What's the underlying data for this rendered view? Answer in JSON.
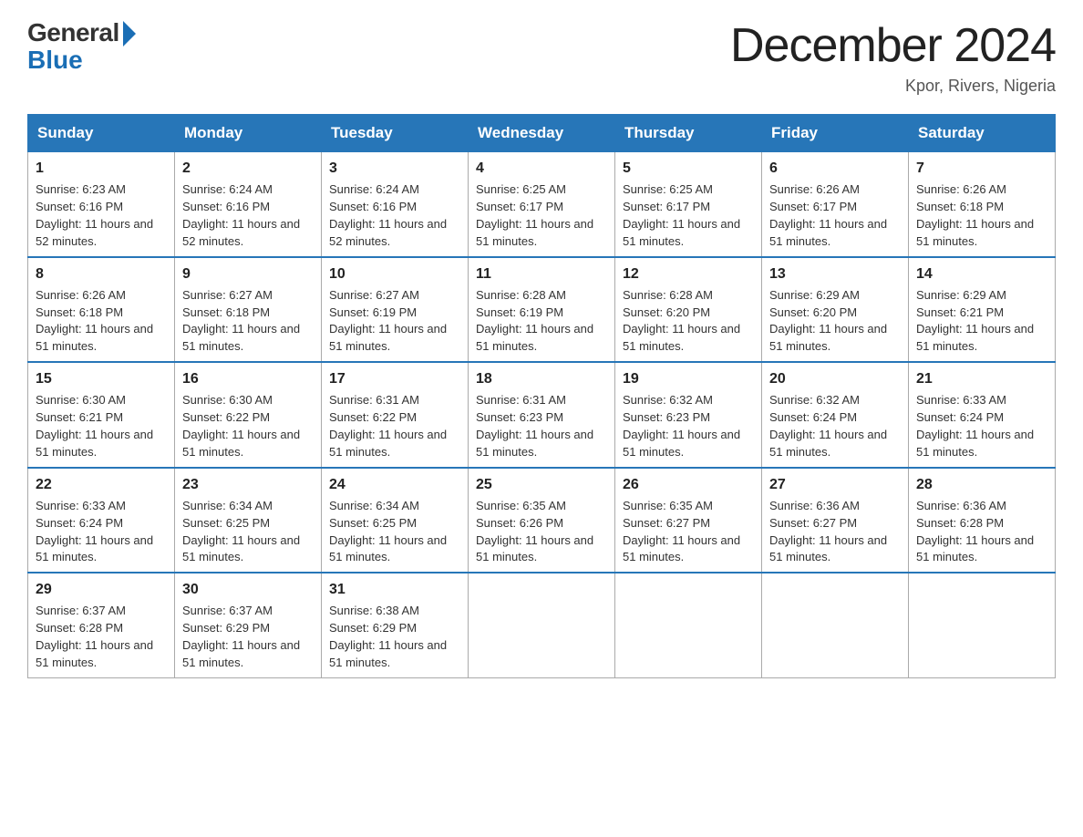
{
  "logo": {
    "general": "General",
    "blue": "Blue"
  },
  "title": "December 2024",
  "location": "Kpor, Rivers, Nigeria",
  "days": [
    "Sunday",
    "Monday",
    "Tuesday",
    "Wednesday",
    "Thursday",
    "Friday",
    "Saturday"
  ],
  "weeks": [
    [
      {
        "num": "1",
        "sunrise": "6:23 AM",
        "sunset": "6:16 PM",
        "daylight": "11 hours and 52 minutes."
      },
      {
        "num": "2",
        "sunrise": "6:24 AM",
        "sunset": "6:16 PM",
        "daylight": "11 hours and 52 minutes."
      },
      {
        "num": "3",
        "sunrise": "6:24 AM",
        "sunset": "6:16 PM",
        "daylight": "11 hours and 52 minutes."
      },
      {
        "num": "4",
        "sunrise": "6:25 AM",
        "sunset": "6:17 PM",
        "daylight": "11 hours and 51 minutes."
      },
      {
        "num": "5",
        "sunrise": "6:25 AM",
        "sunset": "6:17 PM",
        "daylight": "11 hours and 51 minutes."
      },
      {
        "num": "6",
        "sunrise": "6:26 AM",
        "sunset": "6:17 PM",
        "daylight": "11 hours and 51 minutes."
      },
      {
        "num": "7",
        "sunrise": "6:26 AM",
        "sunset": "6:18 PM",
        "daylight": "11 hours and 51 minutes."
      }
    ],
    [
      {
        "num": "8",
        "sunrise": "6:26 AM",
        "sunset": "6:18 PM",
        "daylight": "11 hours and 51 minutes."
      },
      {
        "num": "9",
        "sunrise": "6:27 AM",
        "sunset": "6:18 PM",
        "daylight": "11 hours and 51 minutes."
      },
      {
        "num": "10",
        "sunrise": "6:27 AM",
        "sunset": "6:19 PM",
        "daylight": "11 hours and 51 minutes."
      },
      {
        "num": "11",
        "sunrise": "6:28 AM",
        "sunset": "6:19 PM",
        "daylight": "11 hours and 51 minutes."
      },
      {
        "num": "12",
        "sunrise": "6:28 AM",
        "sunset": "6:20 PM",
        "daylight": "11 hours and 51 minutes."
      },
      {
        "num": "13",
        "sunrise": "6:29 AM",
        "sunset": "6:20 PM",
        "daylight": "11 hours and 51 minutes."
      },
      {
        "num": "14",
        "sunrise": "6:29 AM",
        "sunset": "6:21 PM",
        "daylight": "11 hours and 51 minutes."
      }
    ],
    [
      {
        "num": "15",
        "sunrise": "6:30 AM",
        "sunset": "6:21 PM",
        "daylight": "11 hours and 51 minutes."
      },
      {
        "num": "16",
        "sunrise": "6:30 AM",
        "sunset": "6:22 PM",
        "daylight": "11 hours and 51 minutes."
      },
      {
        "num": "17",
        "sunrise": "6:31 AM",
        "sunset": "6:22 PM",
        "daylight": "11 hours and 51 minutes."
      },
      {
        "num": "18",
        "sunrise": "6:31 AM",
        "sunset": "6:23 PM",
        "daylight": "11 hours and 51 minutes."
      },
      {
        "num": "19",
        "sunrise": "6:32 AM",
        "sunset": "6:23 PM",
        "daylight": "11 hours and 51 minutes."
      },
      {
        "num": "20",
        "sunrise": "6:32 AM",
        "sunset": "6:24 PM",
        "daylight": "11 hours and 51 minutes."
      },
      {
        "num": "21",
        "sunrise": "6:33 AM",
        "sunset": "6:24 PM",
        "daylight": "11 hours and 51 minutes."
      }
    ],
    [
      {
        "num": "22",
        "sunrise": "6:33 AM",
        "sunset": "6:24 PM",
        "daylight": "11 hours and 51 minutes."
      },
      {
        "num": "23",
        "sunrise": "6:34 AM",
        "sunset": "6:25 PM",
        "daylight": "11 hours and 51 minutes."
      },
      {
        "num": "24",
        "sunrise": "6:34 AM",
        "sunset": "6:25 PM",
        "daylight": "11 hours and 51 minutes."
      },
      {
        "num": "25",
        "sunrise": "6:35 AM",
        "sunset": "6:26 PM",
        "daylight": "11 hours and 51 minutes."
      },
      {
        "num": "26",
        "sunrise": "6:35 AM",
        "sunset": "6:27 PM",
        "daylight": "11 hours and 51 minutes."
      },
      {
        "num": "27",
        "sunrise": "6:36 AM",
        "sunset": "6:27 PM",
        "daylight": "11 hours and 51 minutes."
      },
      {
        "num": "28",
        "sunrise": "6:36 AM",
        "sunset": "6:28 PM",
        "daylight": "11 hours and 51 minutes."
      }
    ],
    [
      {
        "num": "29",
        "sunrise": "6:37 AM",
        "sunset": "6:28 PM",
        "daylight": "11 hours and 51 minutes."
      },
      {
        "num": "30",
        "sunrise": "6:37 AM",
        "sunset": "6:29 PM",
        "daylight": "11 hours and 51 minutes."
      },
      {
        "num": "31",
        "sunrise": "6:38 AM",
        "sunset": "6:29 PM",
        "daylight": "11 hours and 51 minutes."
      },
      null,
      null,
      null,
      null
    ]
  ]
}
